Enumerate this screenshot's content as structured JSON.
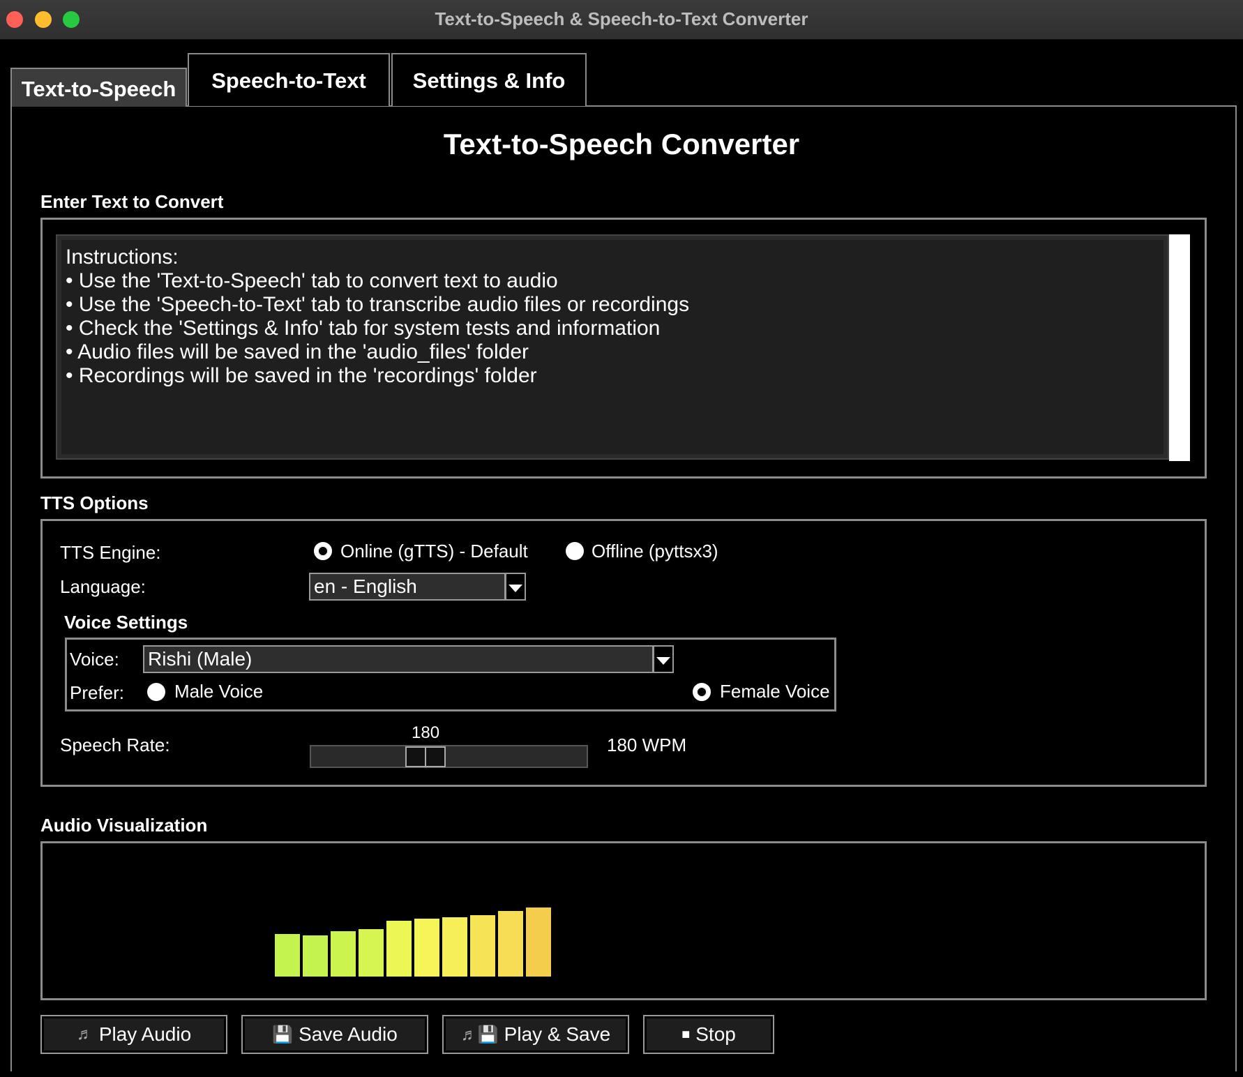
{
  "window": {
    "title": "Text-to-Speech & Speech-to-Text Converter"
  },
  "tabs": [
    {
      "label": "Text-to-Speech",
      "active": true
    },
    {
      "label": "Speech-to-Text",
      "active": false
    },
    {
      "label": "Settings & Info",
      "active": false
    }
  ],
  "main": {
    "heading": "Text-to-Speech Converter",
    "text_section_label": "Enter Text to Convert",
    "text_value": "Instructions:\n• Use the 'Text-to-Speech' tab to convert text to audio\n• Use the 'Speech-to-Text' tab to transcribe audio files or recordings\n• Check the 'Settings & Info' tab for system tests and information\n• Audio files will be saved in the 'audio_files' folder\n• Recordings will be saved in the 'recordings' folder"
  },
  "options": {
    "section_label": "TTS Options",
    "engine_label": "TTS Engine:",
    "engine_online": "Online (gTTS) - Default",
    "engine_offline": "Offline (pyttsx3)",
    "engine_selected": "online",
    "language_label": "Language:",
    "language_value": "en - English",
    "voice_settings_label": "Voice Settings",
    "voice_label": "Voice:",
    "voice_value": "Rishi (Male)",
    "prefer_label": "Prefer:",
    "prefer_male": "Male Voice",
    "prefer_female": "Female Voice",
    "prefer_selected": "female",
    "rate_label": "Speech Rate:",
    "rate_value": "180",
    "rate_display": "180 WPM"
  },
  "visualization": {
    "section_label": "Audio Visualization",
    "bars": [
      {
        "level": 0.55,
        "color": "#c4f24f"
      },
      {
        "level": 0.54,
        "color": "#c4f24f"
      },
      {
        "level": 0.59,
        "color": "#cbf44e"
      },
      {
        "level": 0.62,
        "color": "#d6f550"
      },
      {
        "level": 0.73,
        "color": "#ecf654"
      },
      {
        "level": 0.75,
        "color": "#f5f55a"
      },
      {
        "level": 0.77,
        "color": "#f7ef5a"
      },
      {
        "level": 0.8,
        "color": "#f6e456"
      },
      {
        "level": 0.85,
        "color": "#f7dd55"
      },
      {
        "level": 0.9,
        "color": "#f5cd4c"
      }
    ]
  },
  "buttons": {
    "play_audio": "Play Audio",
    "save_audio": "Save Audio",
    "play_save": "Play & Save",
    "stop": "Stop"
  },
  "icons": {
    "play_audio": "music-note-icon",
    "save_audio": "floppy-disk-icon",
    "play_save": "music-note-floppy-icon",
    "stop": "stop-square-icon"
  }
}
